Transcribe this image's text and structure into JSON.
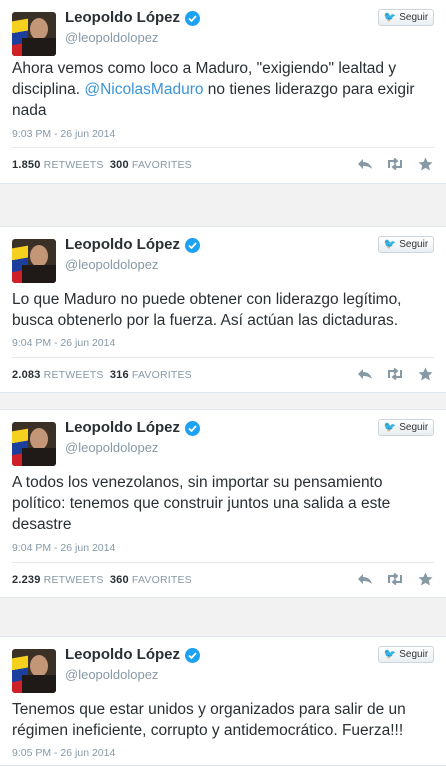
{
  "follow_label": "Seguir",
  "tweets": [
    {
      "name": "Leopoldo López",
      "handle": "@leopoldolopez",
      "text_before": "Ahora vemos como loco a Maduro, \"exigiendo\" lealtad y disciplina. ",
      "mention": "@NicolasMaduro",
      "text_after": " no tienes liderazgo para exigir nada",
      "time": "9:03 PM - 26 jun 2014",
      "retweets": "1.850",
      "retweets_label": "RETWEETS",
      "favorites": "300",
      "favorites_label": "FAVORITES"
    },
    {
      "name": "Leopoldo López",
      "handle": "@leopoldolopez",
      "text": "Lo que Maduro no puede obtener con liderazgo legítimo, busca obtenerlo por la fuerza. Así actúan las dictaduras.",
      "time": "9:04 PM - 26 jun 2014",
      "retweets": "2.083",
      "retweets_label": "RETWEETS",
      "favorites": "316",
      "favorites_label": "FAVORITES"
    },
    {
      "name": "Leopoldo López",
      "handle": "@leopoldolopez",
      "text": "A todos los venezolanos, sin importar su pensamiento político: tenemos que construir juntos una salida a este desastre",
      "time": "9:04 PM - 26 jun 2014",
      "retweets": "2.239",
      "retweets_label": "RETWEETS",
      "favorites": "360",
      "favorites_label": "FAVORITES"
    },
    {
      "name": "Leopoldo López",
      "handle": "@leopoldolopez",
      "text": "Tenemos que estar unidos y organizados para salir de un régimen ineficiente, corrupto y antidemocrático. Fuerza!!!",
      "time": "9:05 PM - 26 jun 2014"
    }
  ],
  "icons": [
    "verified-badge-icon",
    "twitter-bird-icon",
    "reply-icon",
    "retweet-icon",
    "favorite-star-icon"
  ],
  "colors": {
    "accent": "#55acee",
    "mention": "#3b94d9",
    "verified": "#1da1f2",
    "muted": "#8899a6"
  }
}
